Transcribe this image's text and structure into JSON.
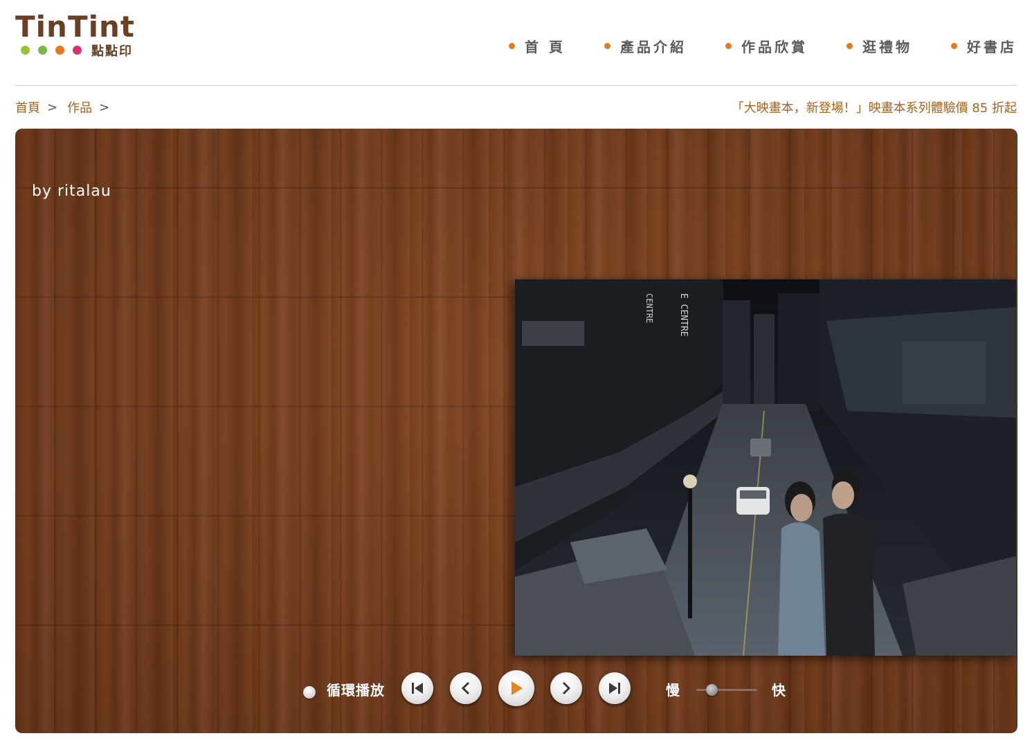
{
  "brand": {
    "word": "TinTint",
    "sub": "點點印",
    "dot_colors": [
      "#9bc13c",
      "#79b843",
      "#e57a22",
      "#d6336c"
    ]
  },
  "nav": {
    "items": [
      {
        "label": "首 頁"
      },
      {
        "label": "產品介紹"
      },
      {
        "label": "作品欣賞"
      },
      {
        "label": "逛禮物"
      },
      {
        "label": "好書店"
      }
    ]
  },
  "breadcrumb": {
    "items": [
      {
        "label": "首頁"
      },
      {
        "label": "作品"
      }
    ],
    "separator": ">"
  },
  "promo": {
    "text": "「大映畫本，新登場！」映畫本系列體驗價 85 折起"
  },
  "viewer": {
    "byline": "by ritalau",
    "controls": {
      "loop_label": "循環播放",
      "first_icon": "skip-to-first-icon",
      "prev_icon": "previous-icon",
      "play_icon": "play-icon",
      "next_icon": "next-icon",
      "last_icon": "skip-to-last-icon",
      "speed_slow": "慢",
      "speed_fast": "快",
      "speed_value": 0.2
    }
  }
}
